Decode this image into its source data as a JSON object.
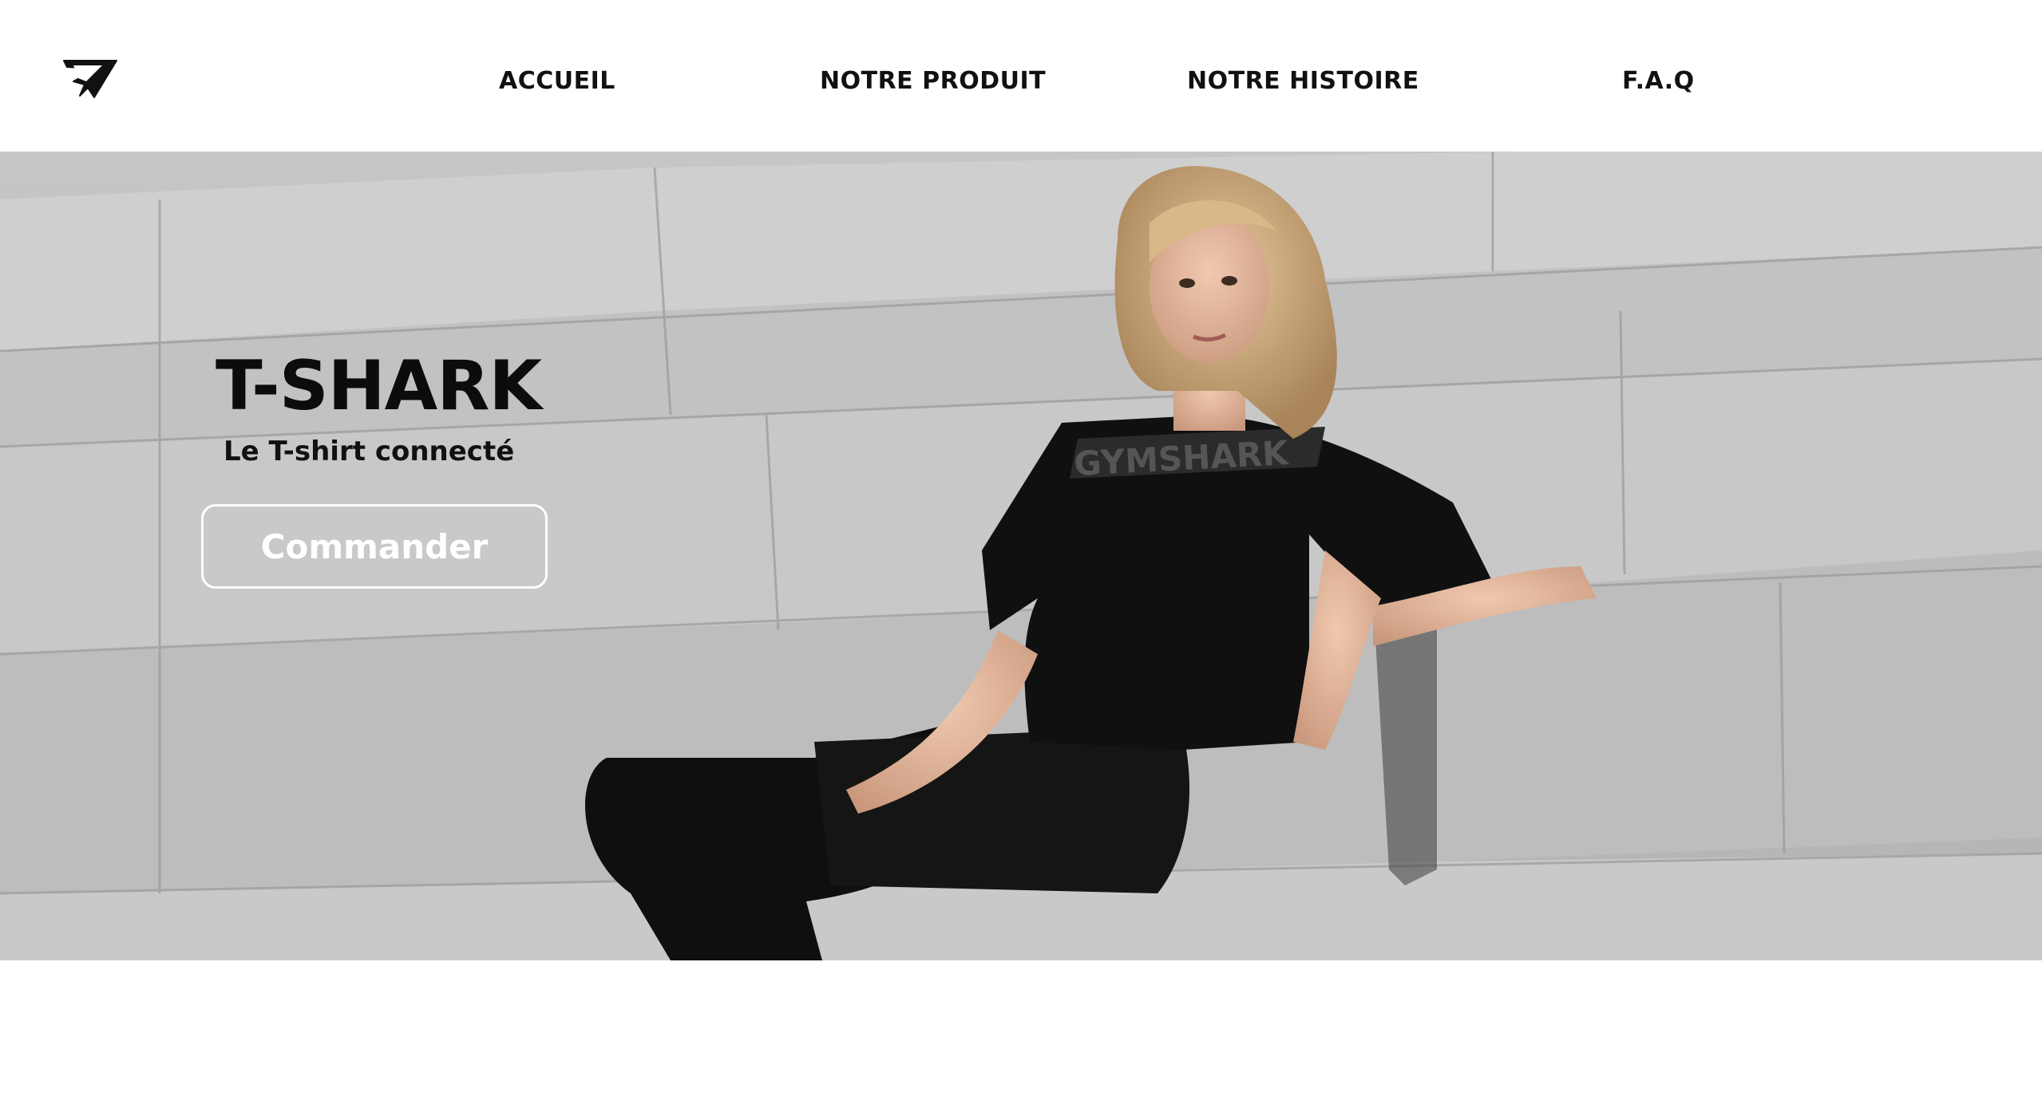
{
  "brand": {
    "logo_icon": "shark-logo-icon"
  },
  "nav": {
    "items": [
      {
        "label": "ACCUEIL"
      },
      {
        "label": "NOTRE PRODUIT"
      },
      {
        "label": "NOTRE HISTOIRE"
      },
      {
        "label": "F.A.Q"
      }
    ]
  },
  "hero": {
    "title": "T-SHARK",
    "subtitle": "Le T-shirt connecté",
    "cta_label": "Commander",
    "image": "woman-in-black-sportswear-on-stone-steps",
    "shirt_print": "GYMSHARK"
  },
  "colors": {
    "header_bg": "#ffffff",
    "nav_text": "#111111",
    "hero_text": "#0c0c0c",
    "cta_border": "#ffffff",
    "cta_text": "#ffffff"
  }
}
